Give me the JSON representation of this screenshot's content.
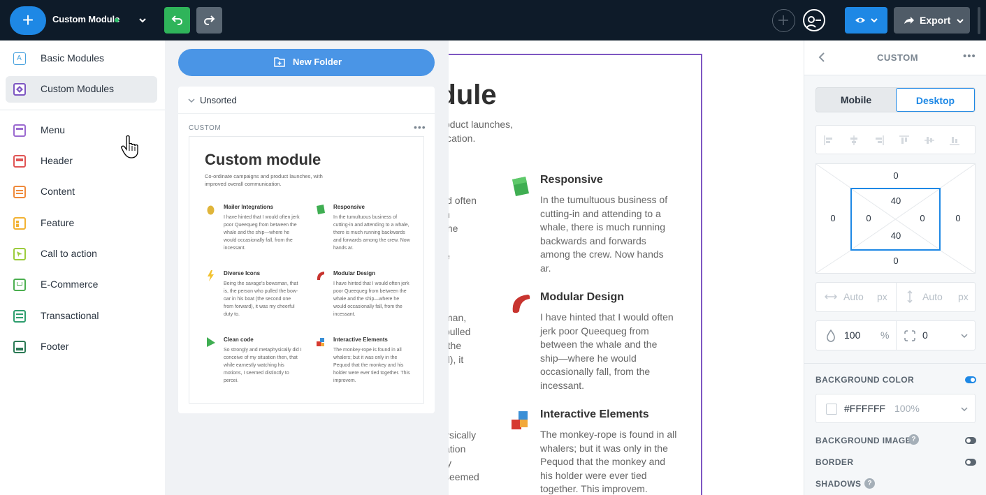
{
  "topbar": {
    "add_symbol": "+",
    "module_name": "Custom Module",
    "export_label": "Export"
  },
  "sidebar": {
    "items": [
      {
        "label": "Basic Modules",
        "color": "#4aa3df"
      },
      {
        "label": "Custom Modules",
        "color": "#7e57c2"
      },
      {
        "label": "Menu",
        "color": "#9b6ad0"
      },
      {
        "label": "Header",
        "color": "#e05555"
      },
      {
        "label": "Content",
        "color": "#ef8a3c"
      },
      {
        "label": "Feature",
        "color": "#f2b233"
      },
      {
        "label": "Call to action",
        "color": "#9ccc3d"
      },
      {
        "label": "E-Commerce",
        "color": "#4caf50"
      },
      {
        "label": "Transactional",
        "color": "#2e9e6e"
      },
      {
        "label": "Footer",
        "color": "#2b7a55"
      }
    ],
    "basic_letter": "A"
  },
  "folders": {
    "new_folder_label": "New Folder",
    "unsorted_label": "Unsorted",
    "category_label": "CUSTOM",
    "more_label": "•••",
    "thumb": {
      "title": "Custom module",
      "subtitle": "Co-ordinate campaigns and product launches, with improved overall communication.",
      "features": [
        {
          "title": "Mailer Integrations",
          "text": "I have hinted that I would often jerk poor Queequeg from between the whale and the ship—where he would occasionally fall, from the incessant."
        },
        {
          "title": "Responsive",
          "text": "In the tumultuous business of cutting-in and attending to a whale, there is much running backwards and forwards among the crew. Now hands ar."
        },
        {
          "title": "Diverse Icons",
          "text": "Being the savage's bowsman, that is, the person who pulled the bow-oar in his boat (the second one from forward), it was my cheerful duty to."
        },
        {
          "title": "Modular Design",
          "text": "I have hinted that I would often jerk poor Queequeg from between the whale and the ship—where he would occasionally fall, from the incessant."
        },
        {
          "title": "Clean code",
          "text": "So strongly and metaphysically did I conceive of my situation then, that while earnestly watching his motions, I seemed distinctly to percei."
        },
        {
          "title": "Interactive Elements",
          "text": "The monkey-rope is found in all whalers; but it was only in the Pequod that the monkey and his holder were ever tied together. This improvem."
        }
      ]
    }
  },
  "canvas": {
    "title_fragment": "odule",
    "subtitle_fragment": "oduct launches,\nication.",
    "left_col_frags": [
      "ld often\nn\nthe\n\ne",
      "man,\npulled\n(the\nd), it\n.",
      "ysically\nation\nly\nseemed"
    ],
    "features": [
      {
        "title": "Responsive",
        "text": "In the tumultuous business of cutting-in and attending to a whale, there is much running backwards and forwards among the crew. Now hands ar."
      },
      {
        "title": "Modular Design",
        "text": "I have hinted that I would often jerk poor Queequeg from between the whale and the ship—where he would occasionally fall, from the incessant."
      },
      {
        "title": "Interactive Elements",
        "text": "The monkey-rope is found in all whalers; but it was only in the Pequod that the monkey and his holder were ever tied together. This improvem."
      }
    ]
  },
  "rpanel": {
    "title": "CUSTOM",
    "more_label": "•••",
    "mobile_label": "Mobile",
    "desktop_label": "Desktop",
    "spacing": {
      "margin_top": "0",
      "margin_bottom": "0",
      "margin_left": "0",
      "margin_right": "0",
      "padding_top": "40",
      "padding_bottom": "40",
      "padding_left": "0",
      "padding_right": "0"
    },
    "width_placeholder": "Auto",
    "height_placeholder": "Auto",
    "unit_px": "px",
    "opacity_value": "100",
    "opacity_unit": "%",
    "radius_value": "0",
    "background_color_label": "BACKGROUND COLOR",
    "color_hex": "#FFFFFF",
    "color_opacity": "100%",
    "background_image_label": "BACKGROUND IMAGE",
    "border_label": "BORDER",
    "shadows_label": "SHADOWS",
    "help_symbol": "?"
  }
}
